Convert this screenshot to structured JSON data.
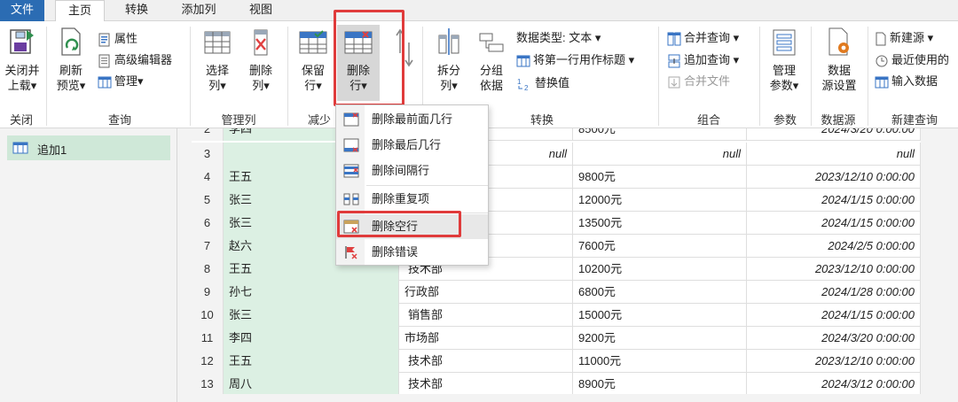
{
  "menu": {
    "file": "文件",
    "home": "主页",
    "transform": "转换",
    "add_column": "添加列",
    "view": "视图"
  },
  "ribbon": {
    "close": {
      "btn_l1": "关闭并",
      "btn_l2": "上载▾",
      "label": "关闭"
    },
    "query": {
      "refresh_l1": "刷新",
      "refresh_l2": "预览▾",
      "properties": "属性",
      "advanced_editor": "高级编辑器",
      "manage": "管理▾",
      "label": "查询"
    },
    "manage_cols": {
      "choose_l1": "选择",
      "choose_l2": "列▾",
      "remove_l1": "删除",
      "remove_l2": "列▾",
      "label": "管理列"
    },
    "reduce_rows": {
      "keep_l1": "保留",
      "keep_l2": "行▾",
      "remove_l1": "删除",
      "remove_l2": "行▾",
      "label": "减少"
    },
    "transform": {
      "split_l1": "拆分",
      "split_l2": "列▾",
      "group_l1": "分组",
      "group_l2": "依据",
      "data_type": "数据类型: 文本 ▾",
      "first_row_header": "将第一行用作标题 ▾",
      "replace_values": "替换值",
      "label": "转换"
    },
    "combine": {
      "merge_queries": "合并查询 ▾",
      "append_queries": "追加查询 ▾",
      "merge_files": "合并文件",
      "label": "组合"
    },
    "params": {
      "manage_l1": "管理",
      "manage_l2": "参数▾",
      "label": "参数"
    },
    "datasource": {
      "settings_l1": "数据",
      "settings_l2": "源设置",
      "label": "数据源"
    },
    "new_query": {
      "new_source": "新建源 ▾",
      "recent_sources": "最近使用的",
      "enter_data": "输入数据",
      "label": "新建查询"
    }
  },
  "queries": {
    "item": "追加1"
  },
  "dropdown": {
    "items": [
      "删除最前面几行",
      "删除最后几行",
      "删除间隔行",
      "删除重复项",
      "删除空行",
      "删除错误"
    ]
  },
  "grid": {
    "rows": [
      {
        "n": "2",
        "name": "李四",
        "dept": "",
        "salary": "8500元",
        "date": "2024/3/20 0:00:00"
      },
      {
        "n": "3",
        "name": "",
        "dept": "",
        "salary": "null",
        "date": "null",
        "null_name": "null"
      },
      {
        "n": "4",
        "name": "王五",
        "dept": "",
        "salary": "9800元",
        "date": "2023/12/10 0:00:00"
      },
      {
        "n": "5",
        "name": "张三",
        "dept": "",
        "salary": "12000元",
        "date": "2024/1/15 0:00:00"
      },
      {
        "n": "6",
        "name": "张三",
        "dept": "",
        "salary": "13500元",
        "date": "2024/1/15 0:00:00"
      },
      {
        "n": "7",
        "name": "赵六",
        "dept": "",
        "salary": "7600元",
        "date": "2024/2/5 0:00:00"
      },
      {
        "n": "8",
        "name": "王五",
        "dept": "技术部",
        "salary": "10200元",
        "date": "2023/12/10 0:00:00"
      },
      {
        "n": "9",
        "name": "孙七",
        "dept": "行政部",
        "salary": "6800元",
        "date": "2024/1/28 0:00:00"
      },
      {
        "n": "10",
        "name": "张三",
        "dept": "销售部",
        "salary": "15000元",
        "date": "2024/1/15 0:00:00"
      },
      {
        "n": "11",
        "name": "李四",
        "dept": "市场部",
        "salary": "9200元",
        "date": "2024/3/20 0:00:00"
      },
      {
        "n": "12",
        "name": "王五",
        "dept": "技术部",
        "salary": "11000元",
        "date": "2023/12/10 0:00:00"
      },
      {
        "n": "13",
        "name": "周八",
        "dept": "技术部",
        "salary": "8900元",
        "date": "2024/3/12 0:00:00"
      }
    ]
  },
  "colors": {
    "accent": "#2b6cb3",
    "highlight": "#e03b3b",
    "selected_col": "#dcf0e3"
  }
}
